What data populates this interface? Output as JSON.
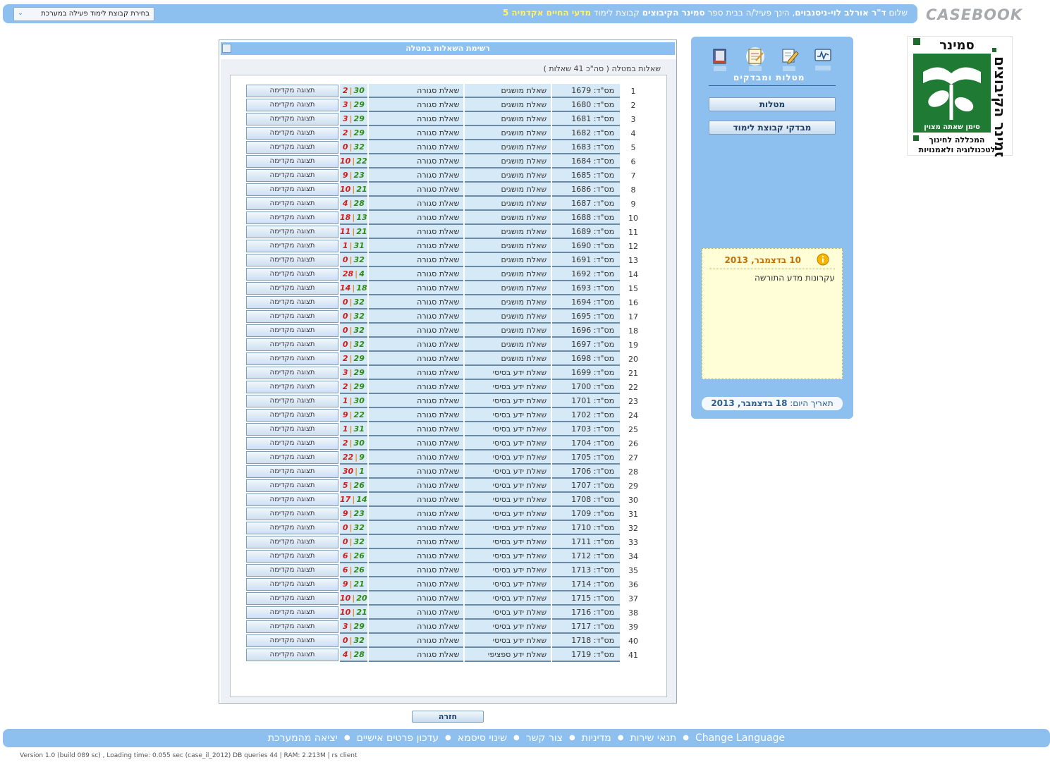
{
  "brand": "CASEBOOK",
  "top": {
    "greeting_prefix": "שלום",
    "user_name": "ד\"ר אורלב לוי-ניסנבוים",
    "greeting_mid": ", הינך פעיל/ה בבית ספר",
    "school": "סמינר הקיבוצים",
    "group_label": "קבוצת לימוד",
    "group": "מדעי החיים אקדמיה 5",
    "group_select_label": "בחירת קבוצת לימוד פעילה במערכת"
  },
  "logo": {
    "title": "סמינר הקיבוצים",
    "motto": "סימן שאתה מצוין",
    "line1": "המכללה לחינוך",
    "line2": "לטכנולוגיה ולאמנויות"
  },
  "side": {
    "nav_caption": "מטלות ומבדקים",
    "nav_icons": [
      "activity-monitor-icon",
      "edit-task-icon",
      "notebook-icon",
      "books-icon"
    ],
    "buttons": [
      "מטלות",
      "מבדקי קבוצת לימוד"
    ],
    "notice": {
      "date": "10 בדצמבר, 2013",
      "text": "עקרונות מדע התורשה"
    },
    "today_label": "תאריך היום:",
    "today_day": "18",
    "today_rest": "בדצמבר, 2013"
  },
  "main": {
    "title": "רשימת השאלות במטלה",
    "summary": "שאלות במטלה  ( סה\"כ 41 שאלות )",
    "preview_label": "תצוגה מקדימה",
    "back_label": "חזרה",
    "rows": [
      {
        "n": "1",
        "id": "מס\"ד: 1679",
        "kind": "שאלת מושגים",
        "closed": "שאלת סגורה",
        "good": "30",
        "bad": "2"
      },
      {
        "n": "2",
        "id": "מס\"ד: 1680",
        "kind": "שאלת מושגים",
        "closed": "שאלת סגורה",
        "good": "29",
        "bad": "3"
      },
      {
        "n": "3",
        "id": "מס\"ד: 1681",
        "kind": "שאלת מושגים",
        "closed": "שאלת סגורה",
        "good": "29",
        "bad": "3"
      },
      {
        "n": "4",
        "id": "מס\"ד: 1682",
        "kind": "שאלת מושגים",
        "closed": "שאלת סגורה",
        "good": "29",
        "bad": "2"
      },
      {
        "n": "5",
        "id": "מס\"ד: 1683",
        "kind": "שאלת מושגים",
        "closed": "שאלת סגורה",
        "good": "32",
        "bad": "0"
      },
      {
        "n": "6",
        "id": "מס\"ד: 1684",
        "kind": "שאלת מושגים",
        "closed": "שאלת סגורה",
        "good": "22",
        "bad": "10"
      },
      {
        "n": "7",
        "id": "מס\"ד: 1685",
        "kind": "שאלת מושגים",
        "closed": "שאלת סגורה",
        "good": "23",
        "bad": "9"
      },
      {
        "n": "8",
        "id": "מס\"ד: 1686",
        "kind": "שאלת מושגים",
        "closed": "שאלת סגורה",
        "good": "21",
        "bad": "10"
      },
      {
        "n": "9",
        "id": "מס\"ד: 1687",
        "kind": "שאלת מושגים",
        "closed": "שאלת סגורה",
        "good": "28",
        "bad": "4"
      },
      {
        "n": "10",
        "id": "מס\"ד: 1688",
        "kind": "שאלת מושגים",
        "closed": "שאלת סגורה",
        "good": "13",
        "bad": "18"
      },
      {
        "n": "11",
        "id": "מס\"ד: 1689",
        "kind": "שאלת מושגים",
        "closed": "שאלת סגורה",
        "good": "21",
        "bad": "11"
      },
      {
        "n": "12",
        "id": "מס\"ד: 1690",
        "kind": "שאלת מושגים",
        "closed": "שאלת סגורה",
        "good": "31",
        "bad": "1"
      },
      {
        "n": "13",
        "id": "מס\"ד: 1691",
        "kind": "שאלת מושגים",
        "closed": "שאלת סגורה",
        "good": "32",
        "bad": "0"
      },
      {
        "n": "14",
        "id": "מס\"ד: 1692",
        "kind": "שאלת מושגים",
        "closed": "שאלת סגורה",
        "good": "4",
        "bad": "28"
      },
      {
        "n": "15",
        "id": "מס\"ד: 1693",
        "kind": "שאלת מושגים",
        "closed": "שאלת סגורה",
        "good": "18",
        "bad": "14"
      },
      {
        "n": "16",
        "id": "מס\"ד: 1694",
        "kind": "שאלת מושגים",
        "closed": "שאלת סגורה",
        "good": "32",
        "bad": "0"
      },
      {
        "n": "17",
        "id": "מס\"ד: 1695",
        "kind": "שאלת מושגים",
        "closed": "שאלת סגורה",
        "good": "32",
        "bad": "0"
      },
      {
        "n": "18",
        "id": "מס\"ד: 1696",
        "kind": "שאלת מושגים",
        "closed": "שאלת סגורה",
        "good": "32",
        "bad": "0"
      },
      {
        "n": "19",
        "id": "מס\"ד: 1697",
        "kind": "שאלת מושגים",
        "closed": "שאלת סגורה",
        "good": "32",
        "bad": "0"
      },
      {
        "n": "20",
        "id": "מס\"ד: 1698",
        "kind": "שאלת מושגים",
        "closed": "שאלת סגורה",
        "good": "29",
        "bad": "2"
      },
      {
        "n": "21",
        "id": "מס\"ד: 1699",
        "kind": "שאלת ידע בסיסי",
        "closed": "שאלת סגורה",
        "good": "29",
        "bad": "3"
      },
      {
        "n": "22",
        "id": "מס\"ד: 1700",
        "kind": "שאלת ידע בסיסי",
        "closed": "שאלת סגורה",
        "good": "29",
        "bad": "2"
      },
      {
        "n": "23",
        "id": "מס\"ד: 1701",
        "kind": "שאלת ידע בסיסי",
        "closed": "שאלת סגורה",
        "good": "30",
        "bad": "1"
      },
      {
        "n": "24",
        "id": "מס\"ד: 1702",
        "kind": "שאלת ידע בסיסי",
        "closed": "שאלת סגורה",
        "good": "22",
        "bad": "9"
      },
      {
        "n": "25",
        "id": "מס\"ד: 1703",
        "kind": "שאלת ידע בסיסי",
        "closed": "שאלת סגורה",
        "good": "31",
        "bad": "1"
      },
      {
        "n": "26",
        "id": "מס\"ד: 1704",
        "kind": "שאלת ידע בסיסי",
        "closed": "שאלת סגורה",
        "good": "30",
        "bad": "2"
      },
      {
        "n": "27",
        "id": "מס\"ד: 1705",
        "kind": "שאלת ידע בסיסי",
        "closed": "שאלת סגורה",
        "good": "9",
        "bad": "22"
      },
      {
        "n": "28",
        "id": "מס\"ד: 1706",
        "kind": "שאלת ידע בסיסי",
        "closed": "שאלת סגורה",
        "good": "1",
        "bad": "30"
      },
      {
        "n": "29",
        "id": "מס\"ד: 1707",
        "kind": "שאלת ידע בסיסי",
        "closed": "שאלת סגורה",
        "good": "26",
        "bad": "5"
      },
      {
        "n": "30",
        "id": "מס\"ד: 1708",
        "kind": "שאלת ידע בסיסי",
        "closed": "שאלת סגורה",
        "good": "14",
        "bad": "17"
      },
      {
        "n": "31",
        "id": "מס\"ד: 1709",
        "kind": "שאלת ידע בסיסי",
        "closed": "שאלת סגורה",
        "good": "23",
        "bad": "9"
      },
      {
        "n": "32",
        "id": "מס\"ד: 1710",
        "kind": "שאלת ידע בסיסי",
        "closed": "שאלת סגורה",
        "good": "32",
        "bad": "0"
      },
      {
        "n": "33",
        "id": "מס\"ד: 1711",
        "kind": "שאלת ידע בסיסי",
        "closed": "שאלת סגורה",
        "good": "32",
        "bad": "0"
      },
      {
        "n": "34",
        "id": "מס\"ד: 1712",
        "kind": "שאלת ידע בסיסי",
        "closed": "שאלת סגורה",
        "good": "26",
        "bad": "6"
      },
      {
        "n": "35",
        "id": "מס\"ד: 1713",
        "kind": "שאלת ידע בסיסי",
        "closed": "שאלת סגורה",
        "good": "26",
        "bad": "6"
      },
      {
        "n": "36",
        "id": "מס\"ד: 1714",
        "kind": "שאלת ידע בסיסי",
        "closed": "שאלת סגורה",
        "good": "21",
        "bad": "9"
      },
      {
        "n": "37",
        "id": "מס\"ד: 1715",
        "kind": "שאלת ידע בסיסי",
        "closed": "שאלת סגורה",
        "good": "20",
        "bad": "10"
      },
      {
        "n": "38",
        "id": "מס\"ד: 1716",
        "kind": "שאלת ידע בסיסי",
        "closed": "שאלת סגורה",
        "good": "21",
        "bad": "10"
      },
      {
        "n": "39",
        "id": "מס\"ד: 1717",
        "kind": "שאלת ידע בסיסי",
        "closed": "שאלת סגורה",
        "good": "29",
        "bad": "3"
      },
      {
        "n": "40",
        "id": "מס\"ד: 1718",
        "kind": "שאלת ידע בסיסי",
        "closed": "שאלת סגורה",
        "good": "32",
        "bad": "0"
      },
      {
        "n": "41",
        "id": "מס\"ד: 1719",
        "kind": "שאלת ידע ספציפי",
        "closed": "שאלת סגורה",
        "good": "28",
        "bad": "4"
      }
    ]
  },
  "footer": {
    "links": [
      "Change Language",
      "תנאי שירות",
      "מדיניות",
      "צור קשר",
      "שינוי סיסמא",
      "עדכון פרטים אישיים",
      "יציאה מהמערכת"
    ],
    "version": "Version 1.0 (build 089 sc) , Loading time: 0.055 sec  (case_il_2012) DB queries 44 | RAM: 2.213M | rs client"
  },
  "colors": {
    "bar_blue": "#8dc0ef",
    "cell_blue": "#d6e9f7",
    "score_good": "#2e8b12",
    "score_bad": "#d51c1c",
    "notice_bg": "#fffed7",
    "accent_orange": "#c66e00"
  }
}
